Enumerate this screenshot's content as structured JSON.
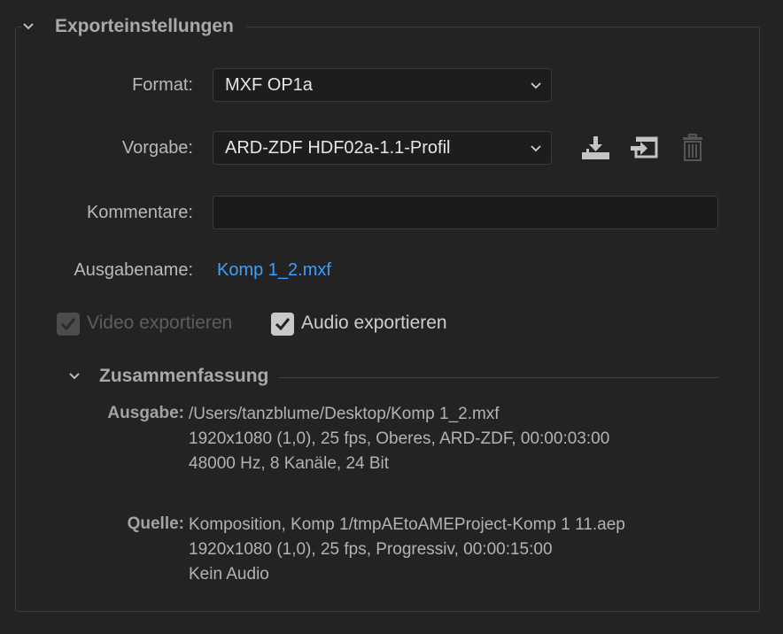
{
  "section": {
    "title": "Exporteinstellungen"
  },
  "format": {
    "label": "Format:",
    "value": "MXF OP1a"
  },
  "preset": {
    "label": "Vorgabe:",
    "value": "ARD-ZDF HDF02a-1.1-Profil"
  },
  "comments": {
    "label": "Kommentare:",
    "value": ""
  },
  "output_name": {
    "label": "Ausgabename:",
    "value": "Komp 1_2.mxf"
  },
  "export_video": {
    "label": "Video exportieren",
    "checked": true,
    "disabled": true
  },
  "export_audio": {
    "label": "Audio exportieren",
    "checked": true,
    "disabled": false
  },
  "summary": {
    "title": "Zusammenfassung",
    "output": {
      "label": "Ausgabe:",
      "lines": [
        "/Users/tanzblume/Desktop/Komp 1_2.mxf",
        "1920x1080 (1,0), 25 fps, Oberes, ARD-ZDF, 00:00:03:00",
        "48000 Hz, 8 Kanäle, 24 Bit"
      ]
    },
    "source": {
      "label": "Quelle:",
      "lines": [
        "Komposition, Komp 1/tmpAEtoAMEProject-Komp 1 11.aep",
        "1920x1080 (1,0), 25 fps, Progressiv, 00:00:15:00",
        "Kein Audio"
      ]
    }
  },
  "icons": {
    "save_preset": "save-preset-icon",
    "import_preset": "import-preset-icon",
    "delete_preset": "trash-icon"
  },
  "colors": {
    "link": "#3f9ef7",
    "background": "#232323"
  }
}
